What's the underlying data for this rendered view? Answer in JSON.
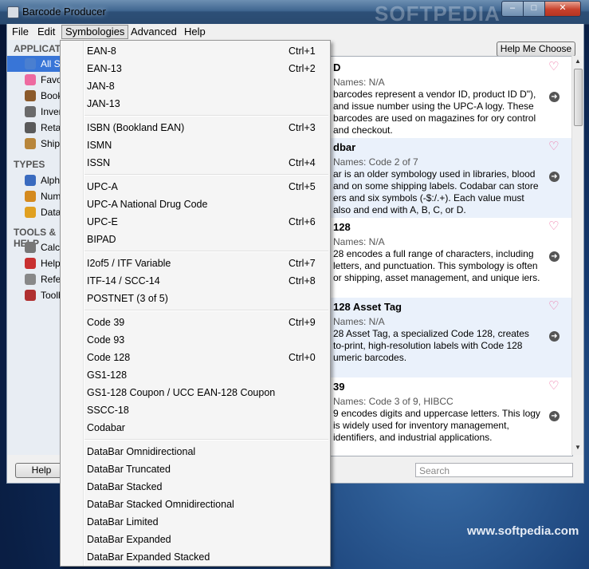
{
  "window": {
    "title": "Barcode Producer",
    "watermark": "SOFTPEDIA",
    "controls": {
      "minimize": "–",
      "maximize": "□",
      "close": "✕"
    }
  },
  "menubar": [
    "File",
    "Edit",
    "Symbologies",
    "Advanced",
    "Help"
  ],
  "sidebar": {
    "sections": [
      {
        "title": "APPLICATIONS",
        "items": [
          {
            "label": "All Symbologies",
            "icon": "globe-icon",
            "color": "#4a7fd0"
          },
          {
            "label": "Favorites",
            "icon": "heart-icon",
            "color": "#ee6aa0"
          },
          {
            "label": "Book Publishing",
            "icon": "book-icon",
            "color": "#8b5a2b"
          },
          {
            "label": "Inventory",
            "icon": "gear-icon",
            "color": "#6a6a6a"
          },
          {
            "label": "Retail",
            "icon": "register-icon",
            "color": "#5a5a5a"
          },
          {
            "label": "Shipping",
            "icon": "box-icon",
            "color": "#b8863b"
          }
        ]
      },
      {
        "title": "TYPES",
        "items": [
          {
            "label": "Alphanumeric",
            "icon": "letters-icon",
            "color": "#3a6bbf"
          },
          {
            "label": "Numeric",
            "icon": "chart-icon",
            "color": "#d48a1e"
          },
          {
            "label": "Data",
            "icon": "cog-icon",
            "color": "#e0a020"
          }
        ]
      },
      {
        "title": "TOOLS & HELP",
        "items": [
          {
            "label": "Calculator",
            "icon": "calculator-icon",
            "color": "#777"
          },
          {
            "label": "Help",
            "icon": "lifebuoy-icon",
            "color": "#c83030"
          },
          {
            "label": "Reference",
            "icon": "document-icon",
            "color": "#888"
          },
          {
            "label": "Toolbox",
            "icon": "toolbox-icon",
            "color": "#b03030"
          }
        ]
      }
    ]
  },
  "help_me_choose": "Help Me Choose",
  "symbologies": [
    {
      "title": "D",
      "aka": "Names: N/A",
      "desc": "barcodes represent a vendor ID, product ID D\"), and issue number using the UPC-A logy. These barcodes are used on magazines for ory control and checkout."
    },
    {
      "title": "dbar",
      "aka": "Names: Code 2 of 7",
      "desc": "ar is an older symbology used in libraries, blood and on some shipping labels. Codabar can store ers and six symbols (-$:/.+). Each value must also and end with A, B, C, or D."
    },
    {
      "title": "128",
      "aka": "Names: N/A",
      "desc": "28 encodes a full range of characters, including letters, and punctuation. This symbology is often or shipping, asset management, and unique iers."
    },
    {
      "title": "128 Asset Tag",
      "aka": "Names: N/A",
      "desc": "28 Asset Tag, a specialized Code 128, creates to-print, high-resolution labels with Code 128 umeric barcodes."
    },
    {
      "title": "39",
      "aka": "Names: Code 3 of 9, HIBCC",
      "desc": "9 encodes digits and uppercase letters. This logy is widely used for inventory management, identifiers, and industrial applications."
    }
  ],
  "bottom": {
    "help_label": "Help",
    "search_placeholder": "Search"
  },
  "watermark_bottom": "www.softpedia.com",
  "dropdown": [
    [
      {
        "label": "EAN-8",
        "shortcut": "Ctrl+1"
      },
      {
        "label": "EAN-13",
        "shortcut": "Ctrl+2"
      },
      {
        "label": "JAN-8",
        "shortcut": ""
      },
      {
        "label": "JAN-13",
        "shortcut": ""
      }
    ],
    [
      {
        "label": "ISBN (Bookland EAN)",
        "shortcut": "Ctrl+3"
      },
      {
        "label": "ISMN",
        "shortcut": ""
      },
      {
        "label": "ISSN",
        "shortcut": "Ctrl+4"
      }
    ],
    [
      {
        "label": "UPC-A",
        "shortcut": "Ctrl+5"
      },
      {
        "label": "UPC-A National Drug Code",
        "shortcut": ""
      },
      {
        "label": "UPC-E",
        "shortcut": "Ctrl+6"
      },
      {
        "label": "BIPAD",
        "shortcut": ""
      }
    ],
    [
      {
        "label": "I2of5 / ITF Variable",
        "shortcut": "Ctrl+7"
      },
      {
        "label": "ITF-14 / SCC-14",
        "shortcut": "Ctrl+8"
      },
      {
        "label": "POSTNET (3 of 5)",
        "shortcut": ""
      }
    ],
    [
      {
        "label": "Code 39",
        "shortcut": "Ctrl+9"
      },
      {
        "label": "Code 93",
        "shortcut": ""
      },
      {
        "label": "Code 128",
        "shortcut": "Ctrl+0"
      },
      {
        "label": "GS1-128",
        "shortcut": ""
      },
      {
        "label": "GS1-128 Coupon / UCC EAN-128 Coupon",
        "shortcut": ""
      },
      {
        "label": "SSCC-18",
        "shortcut": ""
      },
      {
        "label": "Codabar",
        "shortcut": ""
      }
    ],
    [
      {
        "label": "DataBar Omnidirectional",
        "shortcut": ""
      },
      {
        "label": "DataBar Truncated",
        "shortcut": ""
      },
      {
        "label": "DataBar Stacked",
        "shortcut": ""
      },
      {
        "label": "DataBar Stacked Omnidirectional",
        "shortcut": ""
      },
      {
        "label": "DataBar Limited",
        "shortcut": ""
      },
      {
        "label": "DataBar Expanded",
        "shortcut": ""
      },
      {
        "label": "DataBar Expanded Stacked",
        "shortcut": ""
      }
    ]
  ]
}
